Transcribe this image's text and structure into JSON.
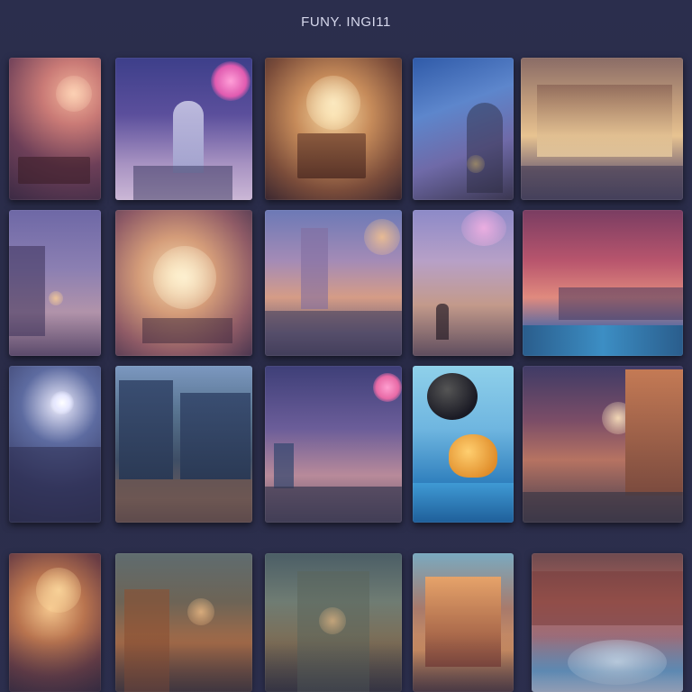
{
  "header": {
    "title": "FUNY. INGI11"
  },
  "gallery": {
    "tiles": [
      {
        "scene": "warm-interior-icon"
      },
      {
        "scene": "city-night-moon-icon"
      },
      {
        "scene": "grand-hall-icon"
      },
      {
        "scene": "blue-night-street-icon"
      },
      {
        "scene": "lit-storefront-icon"
      },
      {
        "scene": "rainy-street-icon"
      },
      {
        "scene": "festival-street-icon"
      },
      {
        "scene": "city-plaza-icon"
      },
      {
        "scene": "city-skyline-figure-icon"
      },
      {
        "scene": "sunset-harbor-icon"
      },
      {
        "scene": "moonlit-street-icon"
      },
      {
        "scene": "tower-blocks-icon"
      },
      {
        "scene": "dusk-city-icon"
      },
      {
        "scene": "balloon-cat-icon"
      },
      {
        "scene": "pink-street-icon"
      },
      {
        "scene": "lantern-alley-icon"
      },
      {
        "scene": "misty-building-icon"
      },
      {
        "scene": "foggy-city-icon"
      },
      {
        "scene": "warm-shopfront-icon"
      },
      {
        "scene": "glowing-river-icon"
      }
    ]
  },
  "colors": {
    "background": "#2a2d4a",
    "title_text": "#d6d8ec"
  }
}
